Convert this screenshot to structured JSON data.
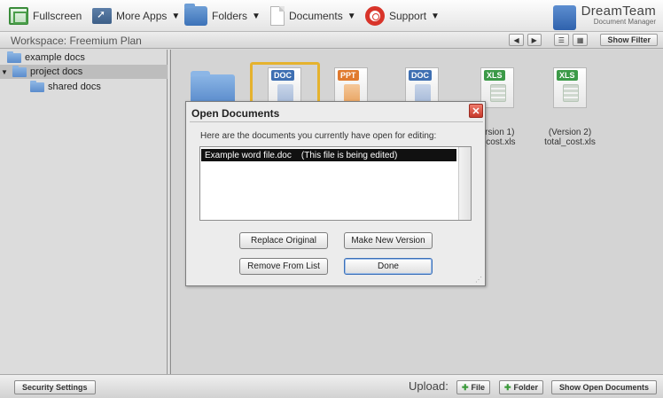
{
  "toolbar": {
    "fullscreen_label": "Fullscreen",
    "more_apps_label": "More Apps",
    "folders_label": "Folders",
    "documents_label": "Documents",
    "support_label": "Support",
    "brand_title": "DreamTeam",
    "brand_subtitle": "Document Manager"
  },
  "workspace": {
    "label": "Workspace: Freemium Plan",
    "prev_label": "◀",
    "next_label": "▶",
    "list_view_label": "☰",
    "grid_view_label": "▦",
    "show_filter_label": "Show Filter"
  },
  "sidebar": {
    "items": [
      {
        "label": "example docs",
        "expanded": false,
        "selected": false,
        "icon": "folder-icon"
      },
      {
        "label": "project docs",
        "expanded": true,
        "selected": true,
        "icon": "folder-open-icon"
      },
      {
        "label": "shared docs",
        "expanded": false,
        "selected": false,
        "icon": "folder-icon"
      }
    ]
  },
  "files": [
    {
      "type": "folder",
      "label": ""
    },
    {
      "type": "DOC",
      "label": "",
      "selected": true
    },
    {
      "type": "PPT",
      "label": ""
    },
    {
      "type": "DOC",
      "label": ""
    },
    {
      "type": "XLS",
      "label_line1": "ersion 1)",
      "label_line2": "l_cost.xls"
    },
    {
      "type": "XLS",
      "label_line1": "(Version 2)",
      "label_line2": "total_cost.xls"
    }
  ],
  "dialog": {
    "title": "Open Documents",
    "close_label": "✕",
    "message": "Here are the documents you currently have open for editing:",
    "list_items": [
      "Example word file.doc    (This file is being edited)"
    ],
    "buttons": {
      "replace_original": "Replace Original",
      "make_new_version": "Make New Version",
      "remove_from_list": "Remove From List",
      "done": "Done"
    }
  },
  "bottombar": {
    "security_settings_label": "Security Settings",
    "upload_label": "Upload:",
    "upload_file_label": "File",
    "upload_folder_label": "Folder",
    "show_open_documents_label": "Show Open Documents"
  }
}
